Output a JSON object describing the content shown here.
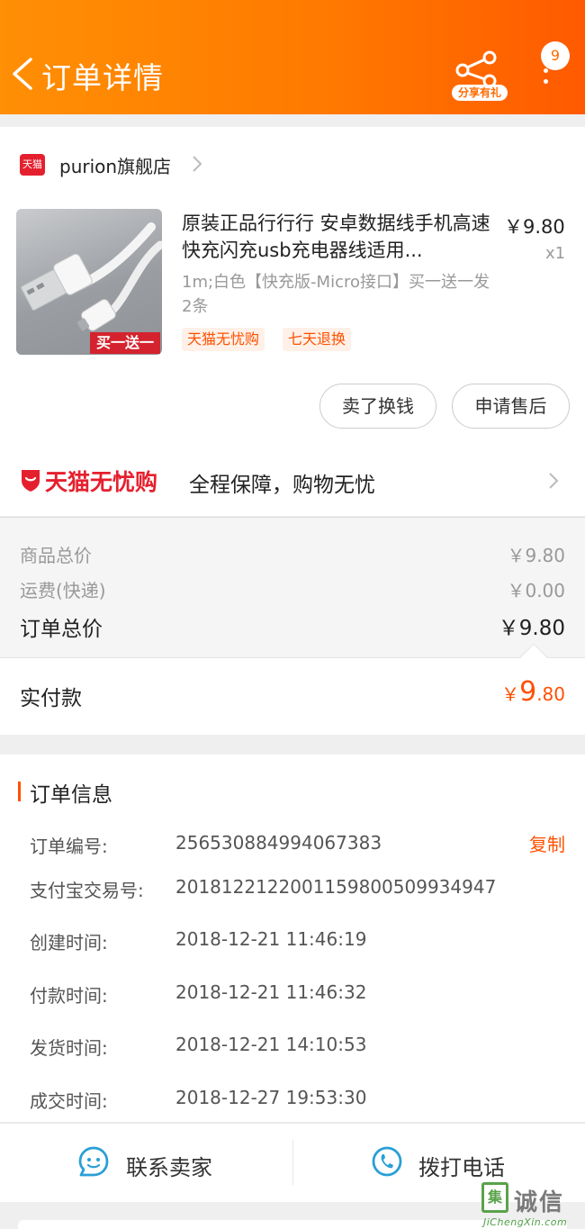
{
  "header": {
    "title": "订单详情",
    "share_label": "分享有礼",
    "message_count": "9",
    "accent_color": "#ff6a00"
  },
  "shop": {
    "platform_badge": "天猫",
    "name": "purion旗舰店",
    "product": {
      "title": "原装正品行行行 安卓数据线手机高速快充闪充usb充电器线适用...",
      "image_tag": "买一送一",
      "price": "￥9.80",
      "quantity": "x1",
      "spec": "1m;白色【快充版-Micro接口】买一送一发2条",
      "tags": [
        "天猫无忧购",
        "七天退换"
      ]
    },
    "buttons": {
      "sell_back": "卖了换钱",
      "after_sale": "申请售后"
    },
    "guarantee": {
      "brand": "天猫无忧购",
      "text": "全程保障，购物无忧"
    }
  },
  "price_summary": {
    "rows": [
      {
        "label": "商品总价",
        "value": "￥9.80"
      },
      {
        "label": "运费(快递)",
        "value": "￥0.00"
      }
    ],
    "order_total_label": "订单总价",
    "order_total_value": "￥9.80",
    "paid_label": "实付款",
    "paid_symbol": "￥",
    "paid_int": "9",
    "paid_dec": ".80"
  },
  "order_info": {
    "title": "订单信息",
    "copy_label": "复制",
    "rows": [
      {
        "label": "订单编号:",
        "value": "256530884994067383"
      },
      {
        "label": "支付宝交易号:",
        "value": "2018122122001159800509934947"
      },
      {
        "label": "创建时间:",
        "value": "2018-12-21 11:46:19"
      },
      {
        "label": "付款时间:",
        "value": "2018-12-21 11:46:32"
      },
      {
        "label": "发货时间:",
        "value": "2018-12-21 14:10:53"
      },
      {
        "label": "成交时间:",
        "value": "2018-12-27 19:53:30"
      }
    ]
  },
  "bottom_bar": {
    "contact_seller": "联系卖家",
    "call_phone": "拨打电话"
  },
  "watermark": {
    "mark": "集",
    "cn": "诚信",
    "en": "JiChengXin.com"
  }
}
